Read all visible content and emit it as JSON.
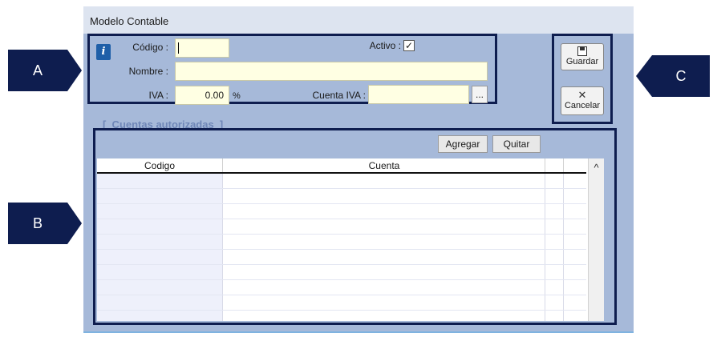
{
  "window": {
    "title": "Modelo Contable"
  },
  "form": {
    "codigo_label": "Código :",
    "codigo_value": "",
    "activo_label": "Activo :",
    "activo_checked": "✓",
    "nombre_label": "Nombre :",
    "nombre_value": "",
    "iva_label": "IVA :",
    "iva_value": "0.00",
    "iva_unit": "%",
    "cuenta_iva_label": "Cuenta IVA :",
    "cuenta_iva_value": "",
    "browse_label": "..."
  },
  "buttons": {
    "guardar": "Guardar",
    "cancelar": "Cancelar"
  },
  "section": {
    "title": "[  Cuentas autorizadas  ]"
  },
  "grid": {
    "agregar": "Agregar",
    "quitar": "Quitar",
    "columns": [
      "Codigo",
      "Cuenta"
    ],
    "scroll_up": "^"
  },
  "callouts": {
    "a": "A",
    "b": "B",
    "c": "C"
  },
  "colors": {
    "frame": "#0e1d4f",
    "window_bg": "#a6b9d9",
    "field_bg": "#ffffe3",
    "callout": "#0e1d4f"
  }
}
